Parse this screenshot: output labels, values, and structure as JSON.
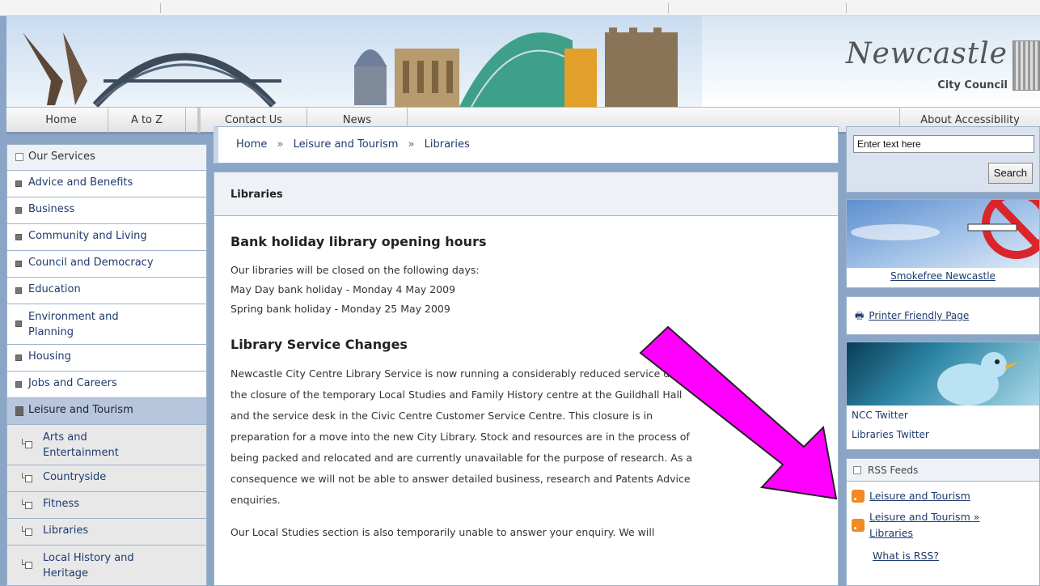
{
  "brand": {
    "title": "Newcastle",
    "subtitle": "City Council"
  },
  "nav": {
    "home": "Home",
    "atoz": "A to Z",
    "contact": "Contact Us",
    "news": "News",
    "accessibility": "About Accessibility"
  },
  "sidebar": {
    "items": [
      {
        "label": "Our Services"
      },
      {
        "label": "Advice and Benefits"
      },
      {
        "label": "Business"
      },
      {
        "label": "Community and Living"
      },
      {
        "label": "Council and Democracy"
      },
      {
        "label": "Education"
      },
      {
        "label": "Environment and Planning"
      },
      {
        "label": "Housing"
      },
      {
        "label": "Jobs and Careers"
      },
      {
        "label": "Leisure and Tourism"
      },
      {
        "label": "Arts and Entertainment"
      },
      {
        "label": "Countryside"
      },
      {
        "label": "Fitness"
      },
      {
        "label": "Libraries"
      },
      {
        "label": "Local History and Heritage"
      }
    ]
  },
  "breadcrumb": {
    "home": "Home",
    "sep": "»",
    "section": "Leisure and Tourism",
    "current": "Libraries"
  },
  "content": {
    "title": "Libraries",
    "heading1": "Bank holiday library opening hours",
    "line1": "Our libraries will be closed on the following days:",
    "line2": "May Day bank holiday - Monday 4 May 2009",
    "line3": "Spring bank holiday - Monday 25 May 2009",
    "heading2": "Library Service Changes",
    "para_lines": [
      "Newcastle City Centre Library Service is now running a considerably reduced service due to",
      "the closure of the temporary Local Studies and Family History centre at the Guildhall Hall",
      "and the service desk in the Civic Centre Customer Service Centre. This closure is in",
      "preparation for a move into the new City Library. Stock and resources are in the process of",
      "being packed and relocated and are currently unavailable for the purpose of research. As a",
      "consequence we will not be able to answer detailed business, research and Patents Advice",
      "enquiries."
    ],
    "para2": "Our Local Studies section is also temporarily unable to answer your enquiry. We will"
  },
  "search": {
    "value": "Enter text here",
    "button": "Search"
  },
  "promo": {
    "smokefree": "Smokefree Newcastle",
    "printer": "Printer Friendly Page",
    "twitter1": "NCC Twitter",
    "twitter2": "Libraries Twitter"
  },
  "rss": {
    "header": "RSS Feeds",
    "item1": "Leisure and Tourism",
    "item2a": "Leisure and Tourism »",
    "item2b": "Libraries",
    "what": "What is RSS?"
  },
  "colors": {
    "annotation_arrow": "#ff00ff",
    "link": "#1e3a6e",
    "page_bg": "#8aa5c6"
  }
}
